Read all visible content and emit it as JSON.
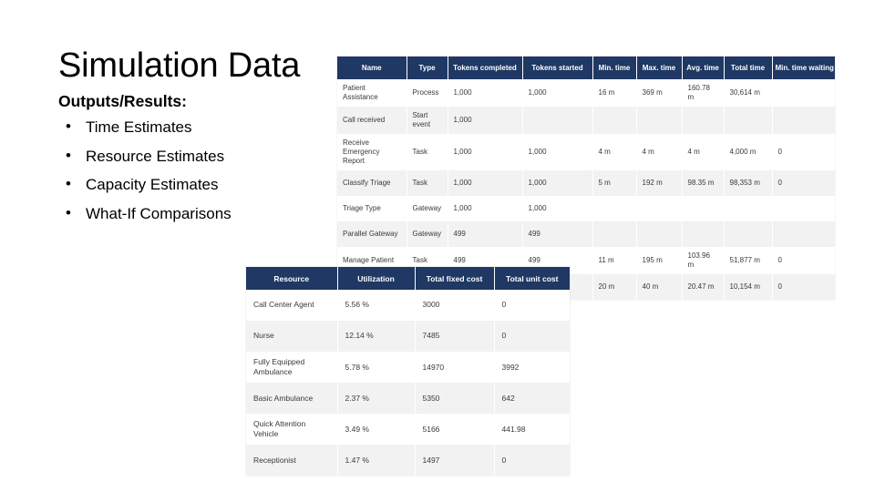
{
  "slide": {
    "title": "Simulation Data",
    "subtitle": "Outputs/Results:",
    "bullet_glyph": "•",
    "bullets": [
      {
        "label": "Time Estimates"
      },
      {
        "label": "Resource Estimates"
      },
      {
        "label": "Capacity Estimates"
      },
      {
        "label": "What-If Comparisons"
      }
    ]
  },
  "colors": {
    "header_navy": "#1F3864",
    "row_alt": "#f2f2f2",
    "row_base": "#ffffff",
    "text": "#000000",
    "cell_text": "#3a3a3a"
  },
  "process_table": {
    "columns": [
      "Name",
      "Type",
      "Tokens completed",
      "Tokens started",
      "Min. time",
      "Max. time",
      "Avg. time",
      "Total time",
      "Min. time waiting"
    ],
    "rows": [
      [
        "Patient Assistance",
        "Process",
        "1,000",
        "1,000",
        "16 m",
        "369 m",
        "160.78 m",
        "30,614 m",
        ""
      ],
      [
        "Call received",
        "Start event",
        "1,000",
        "",
        "",
        "",
        "",
        "",
        ""
      ],
      [
        "Receive Emergency Report",
        "Task",
        "1,000",
        "1,000",
        "4 m",
        "4 m",
        "4 m",
        "4,000 m",
        "0"
      ],
      [
        "Classify Triage",
        "Task",
        "1,000",
        "1,000",
        "5 m",
        "192 m",
        "98.35 m",
        "98,353 m",
        "0"
      ],
      [
        "Triage Type",
        "Gateway",
        "1,000",
        "1,000",
        "",
        "",
        "",
        "",
        ""
      ],
      [
        "Parallel Gateway",
        "Gateway",
        "499",
        "499",
        "",
        "",
        "",
        "",
        ""
      ],
      [
        "Manage Patient",
        "Task",
        "499",
        "499",
        "11 m",
        "195 m",
        "103.96 m",
        "51,877 m",
        "0"
      ],
      [
        "",
        "",
        "",
        "",
        "20 m",
        "40 m",
        "20.47 m",
        "10,154 m",
        "0"
      ]
    ]
  },
  "resource_table": {
    "columns": [
      "Resource",
      "Utilization",
      "Total fixed cost",
      "Total unit cost"
    ],
    "rows": [
      [
        "Call Center Agent",
        "5.56 %",
        "3000",
        "0"
      ],
      [
        "Nurse",
        "12.14 %",
        "7485",
        "0"
      ],
      [
        "Fully Equipped Ambulance",
        "5.78 %",
        "14970",
        "3992"
      ],
      [
        "Basic Ambulance",
        "2.37 %",
        "5350",
        "642"
      ],
      [
        "Quick Attention Vehicle",
        "3.49 %",
        "5166",
        "441.98"
      ],
      [
        "Receptionist",
        "1.47 %",
        "1497",
        "0"
      ]
    ]
  }
}
